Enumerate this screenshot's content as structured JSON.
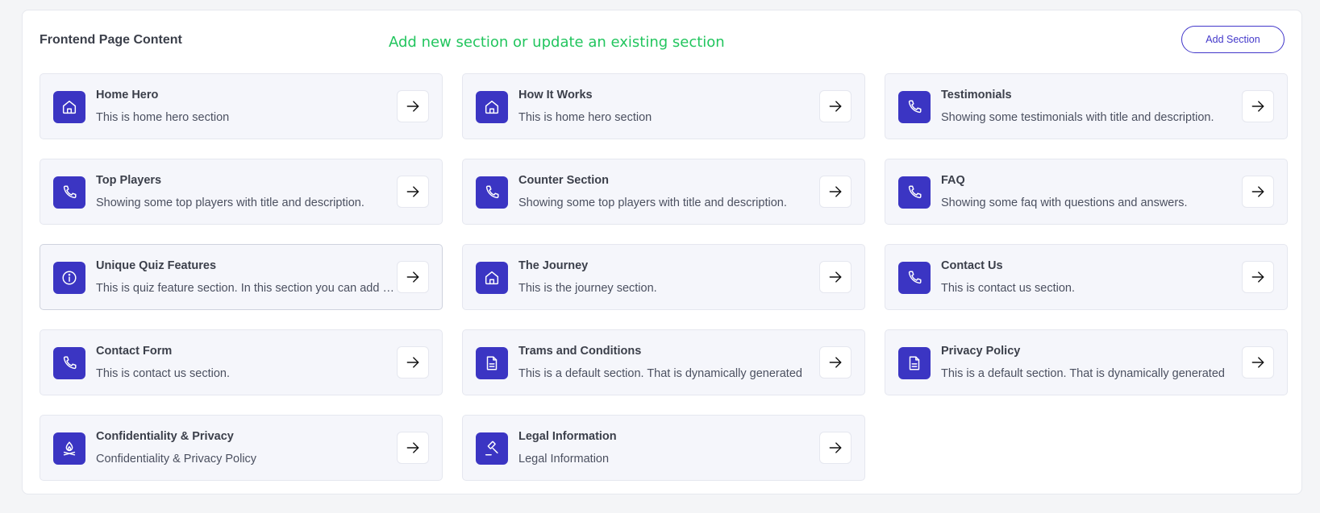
{
  "header": {
    "title": "Frontend Page Content",
    "hint": "Add new section or update an existing section",
    "add_button_label": "Add Section"
  },
  "colors": {
    "accent": "#3b35c3",
    "hint": "#22c55e"
  },
  "sections": [
    {
      "title": "Home Hero",
      "description": "This is home hero section",
      "icon": "home-icon"
    },
    {
      "title": "How It Works",
      "description": "This is home hero section",
      "icon": "home-icon"
    },
    {
      "title": "Testimonials",
      "description": "Showing some testimonials with title and description.",
      "icon": "phone-icon"
    },
    {
      "title": "Top Players",
      "description": "Showing some top players with title and description.",
      "icon": "phone-icon"
    },
    {
      "title": "Counter Section",
      "description": "Showing some top players with title and description.",
      "icon": "phone-icon"
    },
    {
      "title": "FAQ",
      "description": "Showing some faq with questions and answers.",
      "icon": "phone-icon"
    },
    {
      "title": "Unique Quiz Features",
      "description": "This is quiz feature section. In this section you can add quiz features",
      "icon": "info-icon"
    },
    {
      "title": "The Journey",
      "description": "This is the journey section.",
      "icon": "home-icon"
    },
    {
      "title": "Contact Us",
      "description": "This is contact us section.",
      "icon": "phone-icon"
    },
    {
      "title": "Contact Form",
      "description": "This is contact us section.",
      "icon": "phone-icon"
    },
    {
      "title": "Trams and Conditions",
      "description": "This is a default section. That is dynamically generated",
      "icon": "document-icon"
    },
    {
      "title": "Privacy Policy",
      "description": "This is a default section. That is dynamically generated",
      "icon": "document-icon"
    },
    {
      "title": "Confidentiality & Privacy",
      "description": "Confidentiality & Privacy Policy",
      "icon": "campfire-icon"
    },
    {
      "title": "Legal Information",
      "description": "Legal Information",
      "icon": "gavel-icon"
    }
  ]
}
